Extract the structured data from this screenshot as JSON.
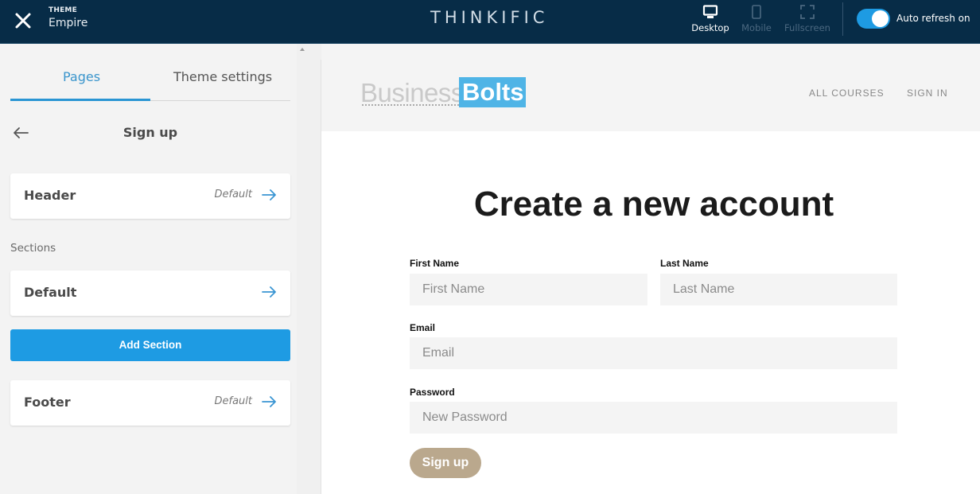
{
  "topbar": {
    "theme_label": "THEME",
    "theme_name": "Empire",
    "brand": "THINKIFIC",
    "devices": [
      {
        "label": "Desktop",
        "icon": "desktop-icon",
        "active": true
      },
      {
        "label": "Mobile",
        "icon": "mobile-icon",
        "active": false
      },
      {
        "label": "Fullscreen",
        "icon": "fullscreen-icon",
        "active": false
      }
    ],
    "auto_refresh_label": "Auto refresh on",
    "auto_refresh_on": true,
    "colors": {
      "bar": "#072c47",
      "toggle": "#1e9be3"
    }
  },
  "sidebar": {
    "tabs": [
      {
        "label": "Pages",
        "active": true
      },
      {
        "label": "Theme settings",
        "active": false
      }
    ],
    "page_title": "Sign up",
    "header_card": {
      "title": "Header",
      "value": "Default"
    },
    "sections_label": "Sections",
    "section_cards": [
      {
        "title": "Default"
      }
    ],
    "add_section_label": "Add Section",
    "footer_card": {
      "title": "Footer",
      "value": "Default"
    },
    "colors": {
      "accent": "#1e9be3"
    }
  },
  "preview": {
    "logo": {
      "part1": "Business",
      "part2": "Bolts"
    },
    "nav": [
      "ALL COURSES",
      "SIGN IN"
    ],
    "title": "Create a new account",
    "fields": {
      "first_name": {
        "label": "First Name",
        "placeholder": "First Name",
        "value": ""
      },
      "last_name": {
        "label": "Last Name",
        "placeholder": "Last Name",
        "value": ""
      },
      "email": {
        "label": "Email",
        "placeholder": "Email",
        "value": ""
      },
      "password": {
        "label": "Password",
        "placeholder": "New Password",
        "value": ""
      }
    },
    "submit_label": "Sign up",
    "colors": {
      "submit": "#baa88d",
      "logo_blue": "#4fb4e6"
    }
  }
}
